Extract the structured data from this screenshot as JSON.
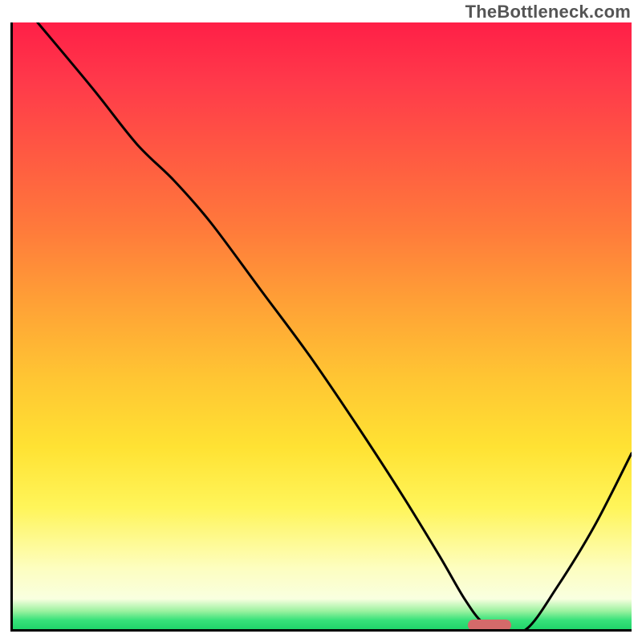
{
  "watermark": "TheBottleneck.com",
  "chart_data": {
    "type": "line",
    "title": "",
    "xlabel": "",
    "ylabel": "",
    "xlim": [
      0,
      100
    ],
    "ylim": [
      0,
      100
    ],
    "x": [
      4,
      13,
      20,
      26,
      32,
      40,
      48,
      56,
      63,
      69,
      73,
      76,
      79,
      83,
      88,
      94,
      100
    ],
    "values": [
      100,
      89,
      80,
      74,
      67,
      56,
      45,
      33,
      22,
      12,
      5,
      1,
      0,
      0,
      7,
      17,
      29
    ],
    "gradient_stops": [
      {
        "pos": 0,
        "color": "#ff1f47"
      },
      {
        "pos": 0.1,
        "color": "#ff3a4a"
      },
      {
        "pos": 0.22,
        "color": "#ff5a42"
      },
      {
        "pos": 0.34,
        "color": "#ff7a3b"
      },
      {
        "pos": 0.46,
        "color": "#ffa036"
      },
      {
        "pos": 0.58,
        "color": "#ffc433"
      },
      {
        "pos": 0.7,
        "color": "#ffe233"
      },
      {
        "pos": 0.8,
        "color": "#fff55a"
      },
      {
        "pos": 0.9,
        "color": "#fdfec0"
      },
      {
        "pos": 0.95,
        "color": "#f9ffe0"
      },
      {
        "pos": 0.97,
        "color": "#9cf2a0"
      },
      {
        "pos": 0.985,
        "color": "#38e27a"
      },
      {
        "pos": 1.0,
        "color": "#20d56a"
      }
    ],
    "marker": {
      "x_center": 77,
      "y": 0,
      "width_pct": 7,
      "color": "#d46a6a"
    }
  }
}
